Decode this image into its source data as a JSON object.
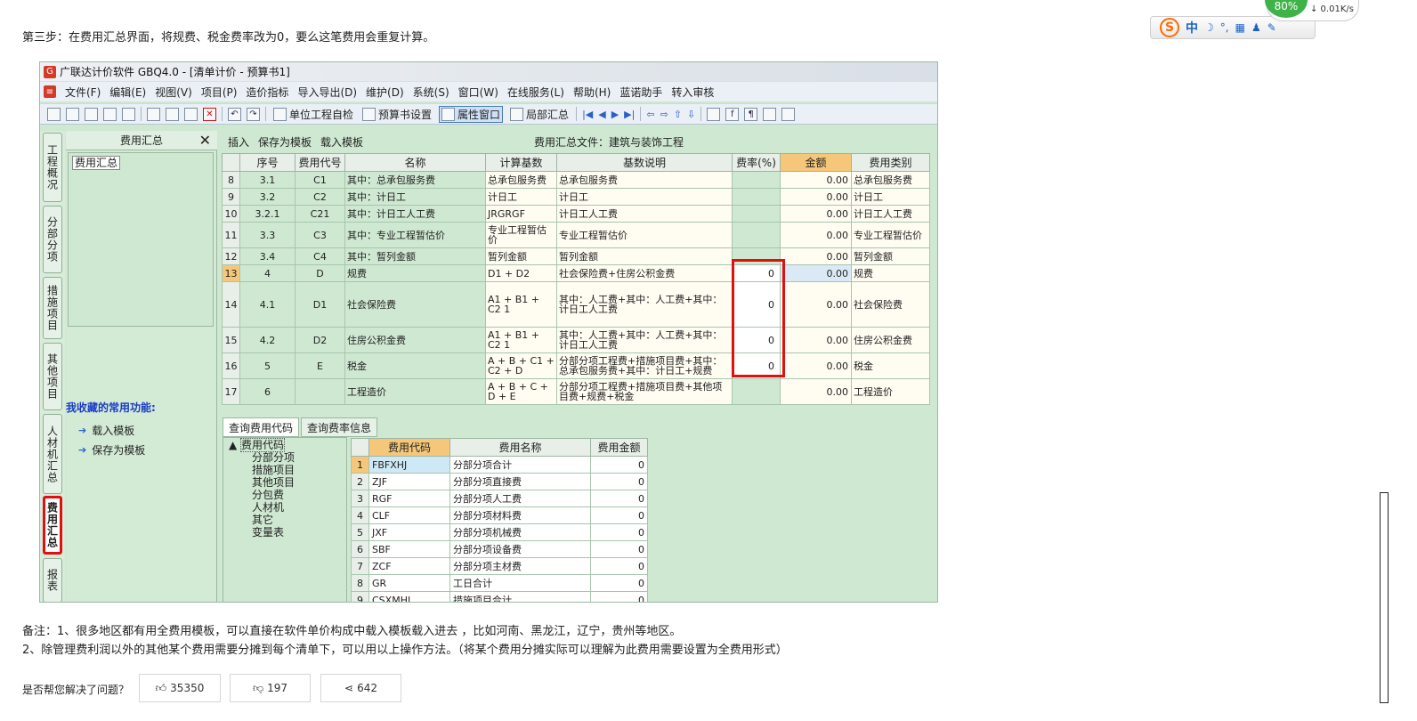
{
  "intro": "第三步：在费用汇总界面，将规费、税金费率改为0，要么这笔费用会重复计算。",
  "ime": {
    "logo": "S",
    "mode": "中",
    "moon": "☽",
    "punct": "°,",
    "kb": "▦",
    "user": "♟",
    "tool": "✎"
  },
  "net": {
    "percent": "80%",
    "speed": "↓ 0.01K/s"
  },
  "app": {
    "title": "广联达计价软件 GBQ4.0 - [清单计价 - 预算书1]",
    "menu": [
      "文件(F)",
      "编辑(E)",
      "视图(V)",
      "项目(P)",
      "造价指标",
      "导入导出(D)",
      "维护(D)",
      "系统(S)",
      "窗口(W)",
      "在线服务(L)",
      "帮助(H)",
      "蓝诺助手",
      "转入审核"
    ],
    "toolbar": {
      "self_check": "单位工程自检",
      "budget_settings": "预算书设置",
      "attr_window": "属性窗口",
      "partial_summary": "局部汇总"
    },
    "vtabs": [
      "工程概况",
      "分部分项",
      "措施项目",
      "其他项目",
      "人材机汇总",
      "费用汇总",
      "报表"
    ],
    "left_panel": {
      "title": "费用汇总",
      "close": "✕",
      "tree_item": "费用汇总",
      "fav_title": "我收藏的常用功能:",
      "fav_items": [
        "载入模板",
        "保存为模板"
      ]
    },
    "grid_tools": {
      "insert": "插入",
      "save_template": "保存为模板",
      "load_template": "载入模板"
    },
    "grid_file": "费用汇总文件：建筑与装饰工程",
    "columns": [
      "序号",
      "费用代号",
      "名称",
      "计算基数",
      "基数说明",
      "费率(%)",
      "金额",
      "费用类别"
    ],
    "rows": [
      {
        "n": "8",
        "seq": "3.1",
        "code": "C1",
        "name": "其中：总承包服务费",
        "base": "总承包服务费",
        "desc": "总承包服务费",
        "rate": "",
        "amt": "0.00",
        "cat": "总承包服务费"
      },
      {
        "n": "9",
        "seq": "3.2",
        "code": "C2",
        "name": "其中：计日工",
        "base": "计日工",
        "desc": "计日工",
        "rate": "",
        "amt": "0.00",
        "cat": "计日工"
      },
      {
        "n": "10",
        "seq": "3.2.1",
        "code": "C21",
        "name": "其中：计日工人工费",
        "base": "JRGRGF",
        "desc": "计日工人工费",
        "rate": "",
        "amt": "0.00",
        "cat": "计日工人工费"
      },
      {
        "n": "11",
        "seq": "3.3",
        "code": "C3",
        "name": "其中：专业工程暂估价",
        "base": "专业工程暂估价",
        "desc": "专业工程暂估价",
        "rate": "",
        "amt": "0.00",
        "cat": "专业工程暂估价"
      },
      {
        "n": "12",
        "seq": "3.4",
        "code": "C4",
        "name": "其中：暂列金额",
        "base": "暂列金额",
        "desc": "暂列金额",
        "rate": "",
        "amt": "0.00",
        "cat": "暂列金额"
      },
      {
        "n": "13",
        "seq": "4",
        "code": "D",
        "name": "规费",
        "base": "D1 + D2",
        "desc": "社会保险费+住房公积金费",
        "rate": "0",
        "amt": "0.00",
        "cat": "规费"
      },
      {
        "n": "14",
        "seq": "4.1",
        "code": "D1",
        "name": "社会保险费",
        "base": "A1 + B1 + C2 1",
        "desc": "其中：人工费+其中：人工费+其中：计日工人工费",
        "rate": "0",
        "amt": "0.00",
        "cat": "社会保险费"
      },
      {
        "n": "15",
        "seq": "4.2",
        "code": "D2",
        "name": "住房公积金费",
        "base": "A1 + B1 + C2 1",
        "desc": "其中：人工费+其中：人工费+其中：计日工人工费",
        "rate": "0",
        "amt": "0.00",
        "cat": "住房公积金费"
      },
      {
        "n": "16",
        "seq": "5",
        "code": "E",
        "name": "税金",
        "base": "A + B + C1 + C2 + D",
        "desc": "分部分项工程费+措施项目费+其中：总承包服务费+其中：计日工+规费",
        "rate": "0",
        "amt": "0.00",
        "cat": "税金"
      },
      {
        "n": "17",
        "seq": "6",
        "code": "",
        "name": "工程造价",
        "base": "A + B + C + D + E",
        "desc": "分部分项工程费+措施项目费+其他项目费+规费+税金",
        "rate": "",
        "amt": "0.00",
        "cat": "工程造价"
      }
    ],
    "bottom_tabs": [
      "查询费用代码",
      "查询费率信息"
    ],
    "code_tree": {
      "root": "费用代码",
      "items": [
        "分部分项",
        "措施项目",
        "其他项目",
        "分包费",
        "人材机",
        "其它",
        "变量表"
      ]
    },
    "sub_columns": [
      "费用代码",
      "费用名称",
      "费用金额"
    ],
    "sub_rows": [
      {
        "n": "1",
        "code": "FBFXHJ",
        "name": "分部分项合计",
        "amt": "0"
      },
      {
        "n": "2",
        "code": "ZJF",
        "name": "分部分项直接费",
        "amt": "0"
      },
      {
        "n": "3",
        "code": "RGF",
        "name": "分部分项人工费",
        "amt": "0"
      },
      {
        "n": "4",
        "code": "CLF",
        "name": "分部分项材料费",
        "amt": "0"
      },
      {
        "n": "5",
        "code": "JXF",
        "name": "分部分项机械费",
        "amt": "0"
      },
      {
        "n": "6",
        "code": "SBF",
        "name": "分部分项设备费",
        "amt": "0"
      },
      {
        "n": "7",
        "code": "ZCF",
        "name": "分部分项主材费",
        "amt": "0"
      },
      {
        "n": "8",
        "code": "GR",
        "name": "工日合计",
        "amt": "0"
      },
      {
        "n": "9",
        "code": "CSXMHJ",
        "name": "措施项目合计",
        "amt": "0"
      }
    ]
  },
  "notes": [
    "备注：1、很多地区都有用全费用模板，可以直接在软件单价构成中载入模板载入进去 ，比如河南、黑龙江，辽宁，贵州等地区。",
    "2、除管理费利润以外的其他某个费用需要分摊到每个清单下，可以用以上操作方法。（将某个费用分摊实际可以理解为此费用需要设置为全费用形式）"
  ],
  "feedback": {
    "question": "是否帮您解决了问题？",
    "like": "35350",
    "dislike": "197",
    "share": "642"
  }
}
